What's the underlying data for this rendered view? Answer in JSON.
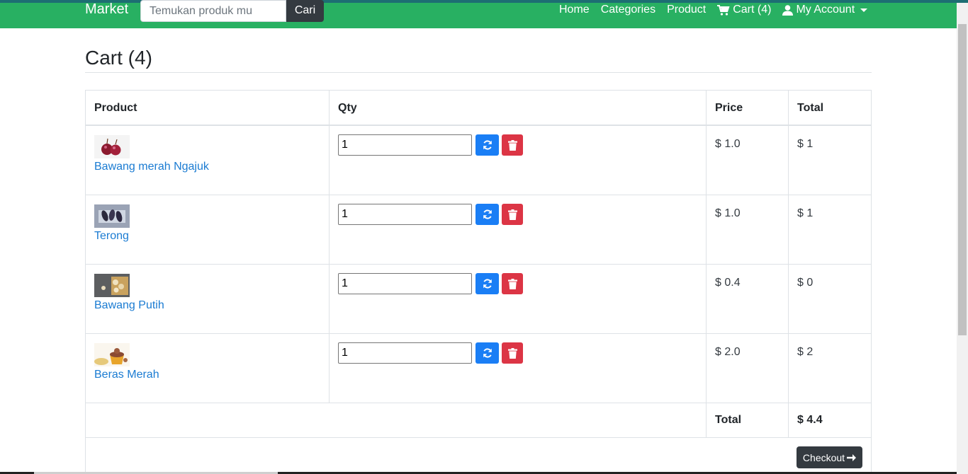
{
  "navbar": {
    "brand": "Market",
    "search_placeholder": "Temukan produk mu",
    "search_button": "Cari",
    "links": {
      "home": "Home",
      "categories": "Categories",
      "product": "Product",
      "cart": "Cart (4)",
      "account": "My Account"
    }
  },
  "page": {
    "title": "Cart (4)"
  },
  "table": {
    "headers": {
      "product": "Product",
      "qty": "Qty",
      "price": "Price",
      "total": "Total"
    },
    "items": [
      {
        "name": "Bawang merah Ngajuk",
        "qty": "1",
        "price": "$ 1.0",
        "total": "$ 1",
        "thumb_icon": "onion-thumbnail"
      },
      {
        "name": "Terong",
        "qty": "1",
        "price": "$ 1.0",
        "total": "$ 1",
        "thumb_icon": "eggplant-thumbnail"
      },
      {
        "name": "Bawang Putih",
        "qty": "1",
        "price": "$ 0.4",
        "total": "$ 0",
        "thumb_icon": "garlic-thumbnail"
      },
      {
        "name": "Beras Merah",
        "qty": "1",
        "price": "$ 2.0",
        "total": "$ 2",
        "thumb_icon": "rice-thumbnail"
      }
    ],
    "grand_total_label": "Total",
    "grand_total_value": "$ 4.4",
    "checkout_label": "Checkout"
  },
  "colors": {
    "navbar": "#28b062",
    "link": "#1a7bd2",
    "refresh_button": "#1a7ef5",
    "delete_button": "#dc3545",
    "dark_button": "#343a40"
  }
}
